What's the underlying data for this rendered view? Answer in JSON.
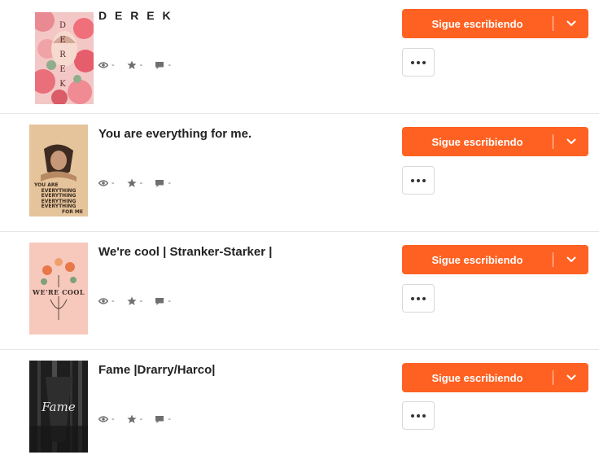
{
  "stories": [
    {
      "title": "D E R E K",
      "cover_text": [
        "D",
        "E",
        "R",
        "E",
        "K"
      ],
      "views": "-",
      "votes": "-",
      "comments": "-",
      "write_label": "Sigue escribiendo"
    },
    {
      "title": "You are everything for me.",
      "cover_text": [
        "YOU ARE",
        "EVERYTHING",
        "EVERYTHING",
        "EVERYTHING",
        "EVERYTHING",
        "FOR ME"
      ],
      "views": "-",
      "votes": "-",
      "comments": "-",
      "write_label": "Sigue escribiendo"
    },
    {
      "title": "We're cool | Stranker-Starker |",
      "cover_text": [
        "WE'RE COOL"
      ],
      "views": "-",
      "votes": "-",
      "comments": "-",
      "write_label": "Sigue escribiendo"
    },
    {
      "title": "Fame |Drarry/Harco|",
      "cover_text": [
        "Fame"
      ],
      "views": "-",
      "votes": "-",
      "comments": "-",
      "write_label": "Sigue escribiendo"
    }
  ],
  "icons": {
    "views": "eye-icon",
    "votes": "star-icon",
    "comments": "comment-icon",
    "dropdown": "chevron-down-icon",
    "more": "more-options-icon"
  },
  "colors": {
    "accent": "#ff6122",
    "stat_text": "#6f6f6f"
  }
}
